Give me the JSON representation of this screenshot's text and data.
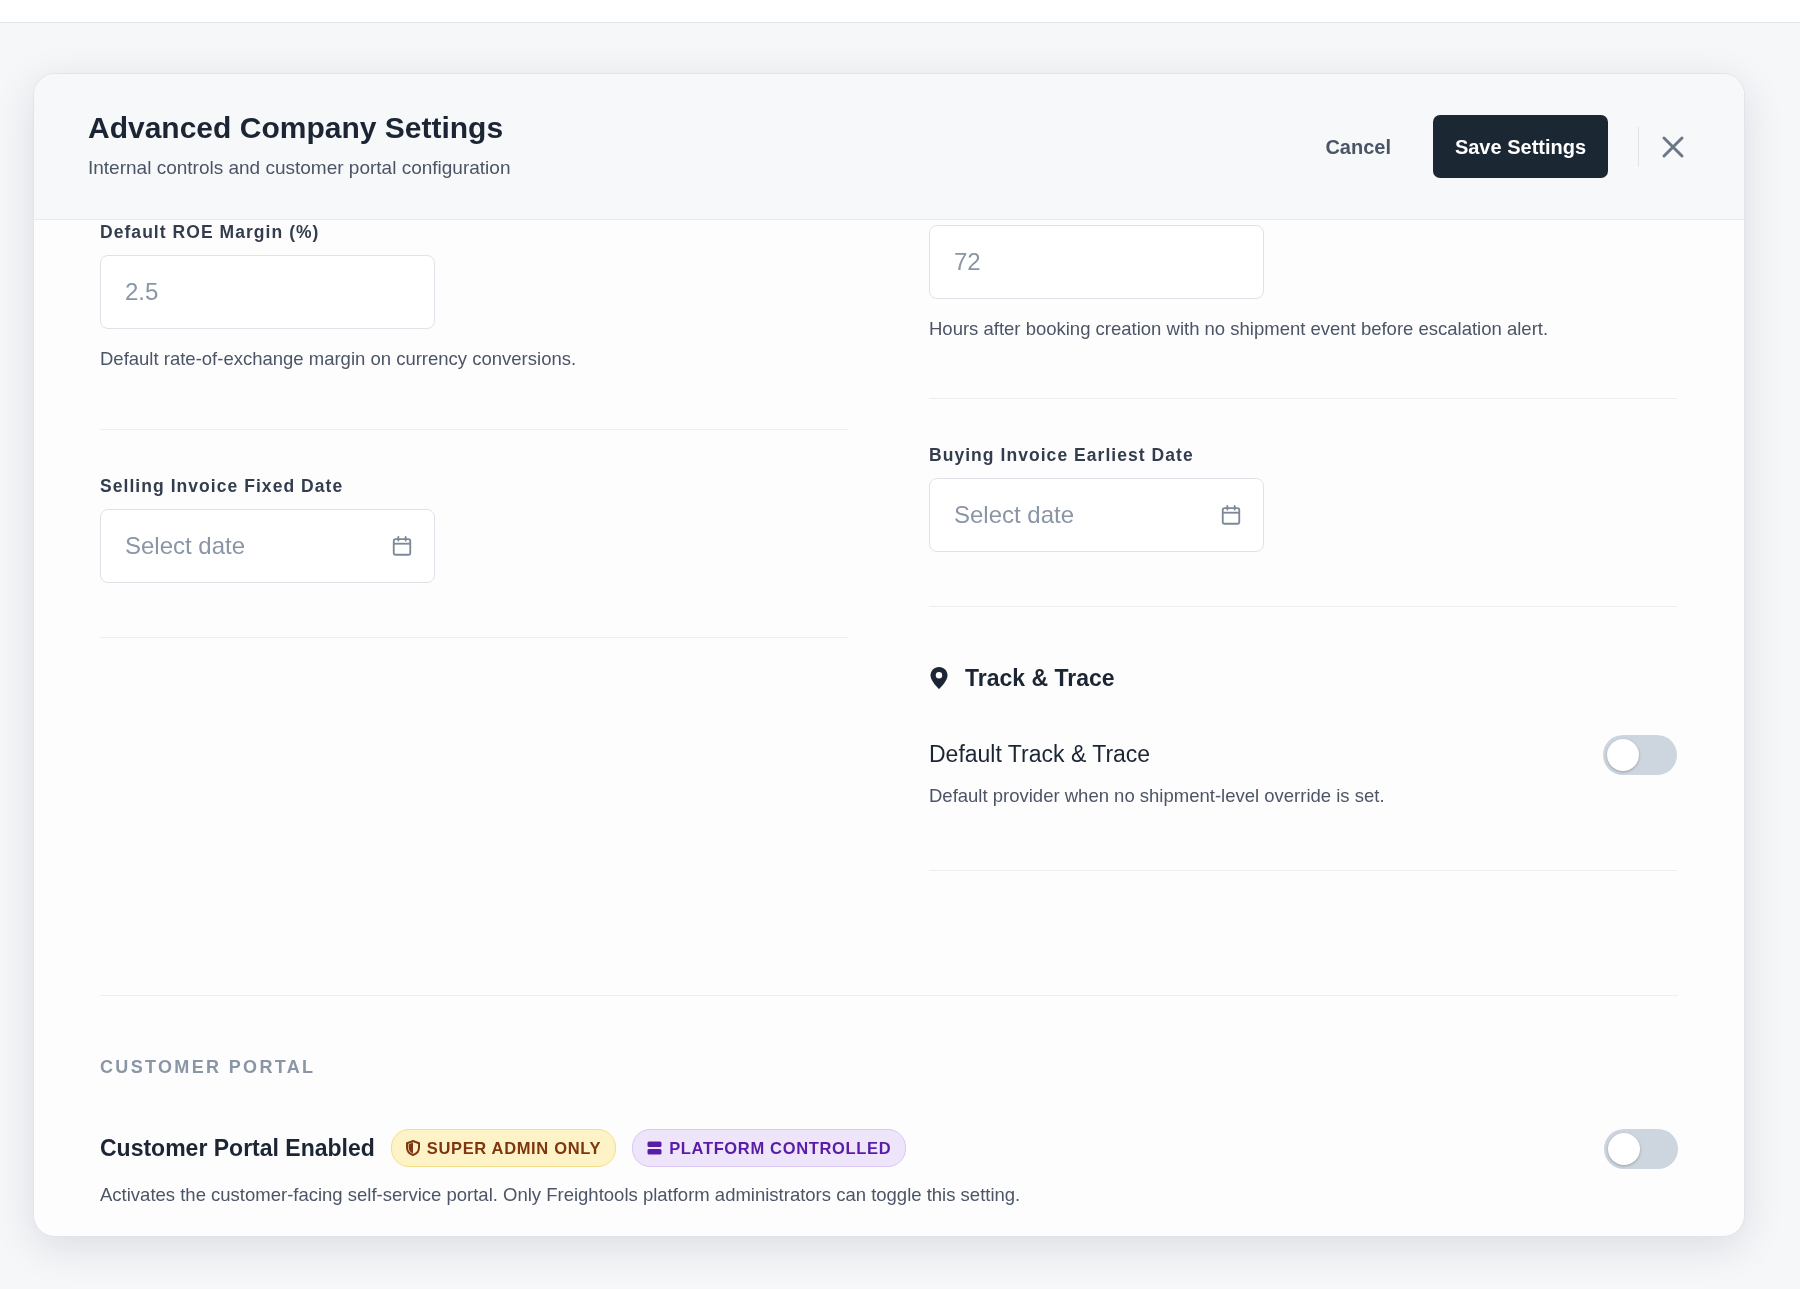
{
  "dialog": {
    "title": "Advanced Company Settings",
    "subtitle": "Internal controls and customer portal configuration",
    "cancel": "Cancel",
    "save": "Save Settings"
  },
  "columns": [
    {
      "sections": [
        {
          "kind": "number",
          "label": "Default ROE Margin (%)",
          "placeholder": "2.5",
          "help": "Default rate-of-exchange margin on currency conversions."
        },
        {
          "kind": "date",
          "label": "Selling Invoice Fixed Date",
          "placeholder": "Select date"
        }
      ]
    },
    {
      "sections": [
        {
          "kind": "number",
          "placeholder": "72",
          "help": "Hours after booking creation with no shipment event before escalation alert."
        },
        {
          "kind": "date",
          "label": "Buying Invoice Earliest Date",
          "placeholder": "Select date"
        },
        {
          "kind": "toggle-group",
          "heading": "Track & Trace",
          "label": "Default Track & Trace",
          "description": "Default provider when no shipment-level override is set.",
          "on": false
        }
      ]
    }
  ],
  "customer_portal": {
    "heading": "CUSTOMER PORTAL",
    "label": "Customer Portal Enabled",
    "badges": [
      {
        "text": "SUPER ADMIN ONLY",
        "kind": "shield"
      },
      {
        "text": "PLATFORM CONTROLLED",
        "kind": "server"
      }
    ],
    "description": "Activates the customer-facing self-service portal. Only Freightools platform administrators can toggle this setting.",
    "on": false
  }
}
